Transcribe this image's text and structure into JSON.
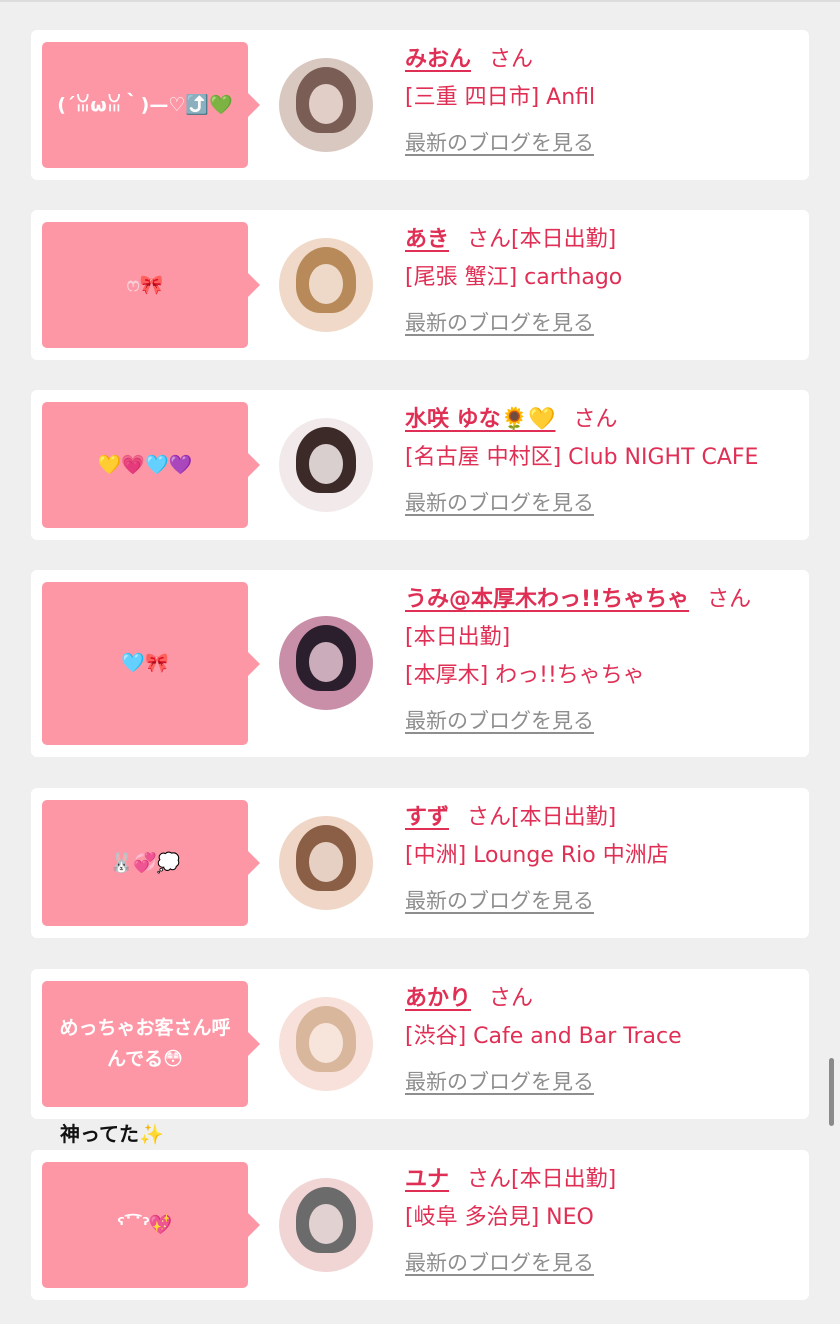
{
  "caption": "神ってた✨",
  "cards": [
    {
      "bubble": "(´ꈍωꈍ｀)—♡⤴️💚",
      "name": "みおん",
      "san": "さん",
      "today": "",
      "shop_lines": [
        "[三重 四日市] Anfil"
      ],
      "blog": "最新のブログを見る",
      "avatar_colors": [
        "#7a5d55",
        "#d9c8c0"
      ]
    },
    {
      "bubble": "ෆ🎀",
      "name": "あき",
      "san": "さん",
      "today": "[本日出勤]",
      "shop_lines": [
        "[尾張 蟹江] carthago"
      ],
      "blog": "最新のブログを見る",
      "avatar_colors": [
        "#b88a5a",
        "#f0d9c8"
      ]
    },
    {
      "bubble": "💛💗🩵💜",
      "name": "水咲 ゆな🌻💛",
      "san": "さん",
      "today": "",
      "shop_lines": [
        "[名古屋 中村区] Club NIGHT CAFE"
      ],
      "blog": "最新のブログを見る",
      "avatar_colors": [
        "#3b2a27",
        "#f2eaea"
      ]
    },
    {
      "bubble": "🩵🎀",
      "name": "うみ@本厚木わっ!!ちゃちゃ",
      "san": "さん",
      "today": "",
      "shop_lines": [
        "[本日出勤]",
        "[本厚木] わっ!!ちゃちゃ"
      ],
      "blog": "最新のブログを見る",
      "avatar_colors": [
        "#2b1f2e",
        "#c98ea8"
      ]
    },
    {
      "bubble": "🐰💞💭",
      "name": "すず",
      "san": "さん",
      "today": "[本日出勤]",
      "shop_lines": [
        "[中洲] Lounge Rio 中洲店"
      ],
      "blog": "最新のブログを見る",
      "avatar_colors": [
        "#8b5e46",
        "#efd6c6"
      ]
    },
    {
      "bubble": "めっちゃお客さん呼んでる😳",
      "name": "あかり",
      "san": "さん",
      "today": "",
      "shop_lines": [
        "[渋谷] Cafe and Bar Trace"
      ],
      "blog": "最新のブログを見る",
      "avatar_colors": [
        "#d9b79c",
        "#f7e1da"
      ]
    },
    {
      "bubble": "ˁ˙͡˙ˀ💖",
      "name": "ユナ",
      "san": "さん",
      "today": "[本日出勤]",
      "shop_lines": [
        "[岐阜 多治見] NEO"
      ],
      "blog": "最新のブログを見る",
      "avatar_colors": [
        "#6b6b6b",
        "#f1d4d4"
      ]
    }
  ]
}
